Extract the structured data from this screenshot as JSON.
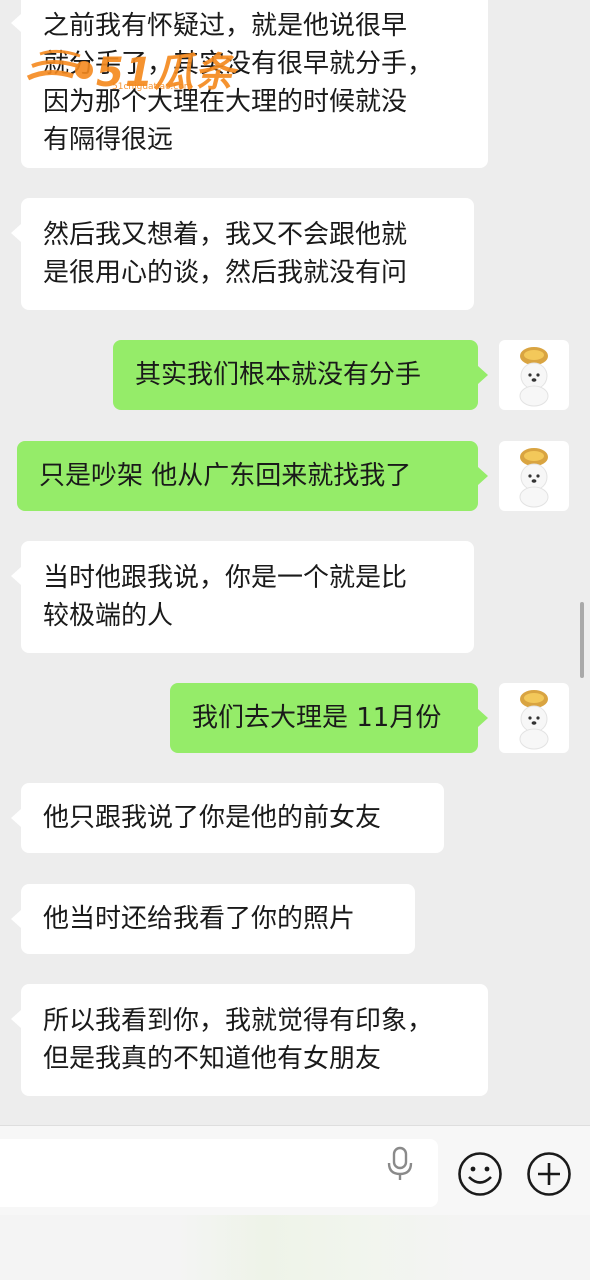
{
  "messages": [
    {
      "side": "left",
      "lines": [
        "之前我有怀疑过，就是他说很早",
        "就分手了，其实没有很早就分手，",
        "因为那个大理在大理的时候就没",
        "有隔得很远"
      ]
    },
    {
      "side": "left",
      "lines": [
        "然后我又想着，我又不会跟他就",
        "是很用心的谈，然后我就没有问"
      ]
    },
    {
      "side": "right",
      "lines": [
        "其实我们根本就没有分手"
      ]
    },
    {
      "side": "right",
      "lines": [
        "只是吵架 他从广东回来就找我了"
      ]
    },
    {
      "side": "left",
      "lines": [
        "当时他跟我说，你是一个就是比",
        "较极端的人"
      ]
    },
    {
      "side": "right",
      "lines": [
        "我们去大理是 11月份"
      ]
    },
    {
      "side": "left",
      "lines": [
        "他只跟我说了你是他的前女友"
      ]
    },
    {
      "side": "left",
      "lines": [
        "他当时还给我看了你的照片"
      ]
    },
    {
      "side": "left",
      "lines": [
        "所以我看到你，我就觉得有印象，",
        "但是我真的不知道他有女朋友"
      ]
    }
  ],
  "watermark": {
    "text": "51瓜条",
    "url": "51chiguatiao.com"
  },
  "input": {
    "placeholder": ""
  },
  "icons": {
    "mic": "microphone-icon",
    "emoji": "emoji-icon",
    "plus": "plus-icon"
  },
  "colors": {
    "background": "#ededed",
    "bubble_sent": "#95ec69",
    "bubble_received": "#ffffff",
    "watermark": "#f58a1f"
  }
}
